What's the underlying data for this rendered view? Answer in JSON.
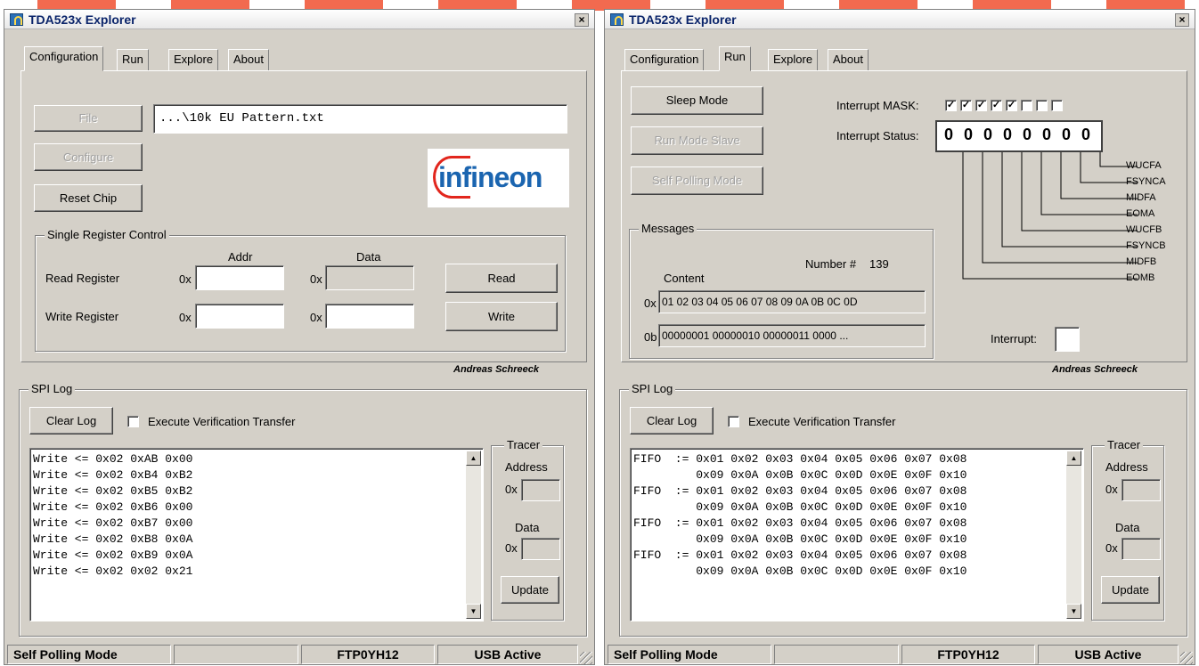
{
  "windows": [
    {
      "title": "TDA523x Explorer",
      "tabs": [
        "Configuration",
        "Run",
        "Explore",
        "About"
      ],
      "active_tab": "Configuration"
    },
    {
      "title": "TDA523x Explorer",
      "tabs": [
        "Configuration",
        "Run",
        "Explore",
        "About"
      ],
      "active_tab": "Run"
    }
  ],
  "close_glyph": "×",
  "config": {
    "file_button": "File",
    "file_path": "...\\10k EU Pattern.txt",
    "configure_button": "Configure",
    "reset_button": "Reset Chip",
    "logo_text": "infineon",
    "single_register_title": "Single Register Control",
    "addr_header": "Addr",
    "data_header": "Data",
    "read_label": "Read Register",
    "write_label": "Write Register",
    "hex_prefix": "0x",
    "read_button": "Read",
    "write_button": "Write"
  },
  "run": {
    "sleep_button": "Sleep Mode",
    "run_slave_button": "Run Mode Slave",
    "self_polling_button": "Self Polling Mode",
    "interrupt_mask_label": "Interrupt MASK:",
    "interrupt_mask": [
      true,
      true,
      true,
      true,
      true,
      false,
      false,
      false
    ],
    "interrupt_status_label": "Interrupt Status:",
    "interrupt_status_bits": [
      "0",
      "0",
      "0",
      "0",
      "0",
      "0",
      "0",
      "0"
    ],
    "bit_labels": [
      "WUCFA",
      "FSYNCA",
      "MIDFA",
      "EOMA",
      "WUCFB",
      "FSYNCB",
      "MIDFB",
      "EOMB"
    ],
    "messages_title": "Messages",
    "number_label": "Number #",
    "number_value": "139",
    "content_label": "Content",
    "hex_prefix": "0x",
    "bin_prefix": "0b",
    "content_hex": "01 02 03 04 05 06 07 08 09 0A 0B 0C 0D",
    "content_bin": "00000001 00000010 00000011 0000 ...",
    "interrupt_label": "Interrupt:"
  },
  "signature": "Andreas Schreeck",
  "spi_log": {
    "title": "SPI Log",
    "clear_button": "Clear Log",
    "verify_label": "Execute Verification Transfer",
    "verify_checked": false,
    "tracer_title": "Tracer",
    "address_label": "Address",
    "data_label": "Data",
    "hex_prefix": "0x",
    "update_button": "Update",
    "left_lines": [
      "Write <= 0x02 0xAB 0x00",
      "Write <= 0x02 0xB4 0xB2",
      "Write <= 0x02 0xB5 0xB2",
      "Write <= 0x02 0xB6 0x00",
      "Write <= 0x02 0xB7 0x00",
      "Write <= 0x02 0xB8 0x0A",
      "Write <= 0x02 0xB9 0x0A",
      "Write <= 0x02 0x02 0x21"
    ],
    "right_lines": [
      "FIFO  := 0x01 0x02 0x03 0x04 0x05 0x06 0x07 0x08",
      "         0x09 0x0A 0x0B 0x0C 0x0D 0x0E 0x0F 0x10",
      "FIFO  := 0x01 0x02 0x03 0x04 0x05 0x06 0x07 0x08",
      "         0x09 0x0A 0x0B 0x0C 0x0D 0x0E 0x0F 0x10",
      "FIFO  := 0x01 0x02 0x03 0x04 0x05 0x06 0x07 0x08",
      "         0x09 0x0A 0x0B 0x0C 0x0D 0x0E 0x0F 0x10",
      "FIFO  := 0x01 0x02 0x03 0x04 0x05 0x06 0x07 0x08",
      "         0x09 0x0A 0x0B 0x0C 0x0D 0x0E 0x0F 0x10"
    ]
  },
  "status": {
    "mode": "Self Polling Mode",
    "device": "FTP0YH12",
    "usb": "USB Active"
  },
  "colors": {
    "title_text": "#0a246a",
    "window_bg": "#d4d0c8",
    "logo_blue": "#1b65b0",
    "logo_red": "#e2261d",
    "background_band": "#f26a4f"
  }
}
